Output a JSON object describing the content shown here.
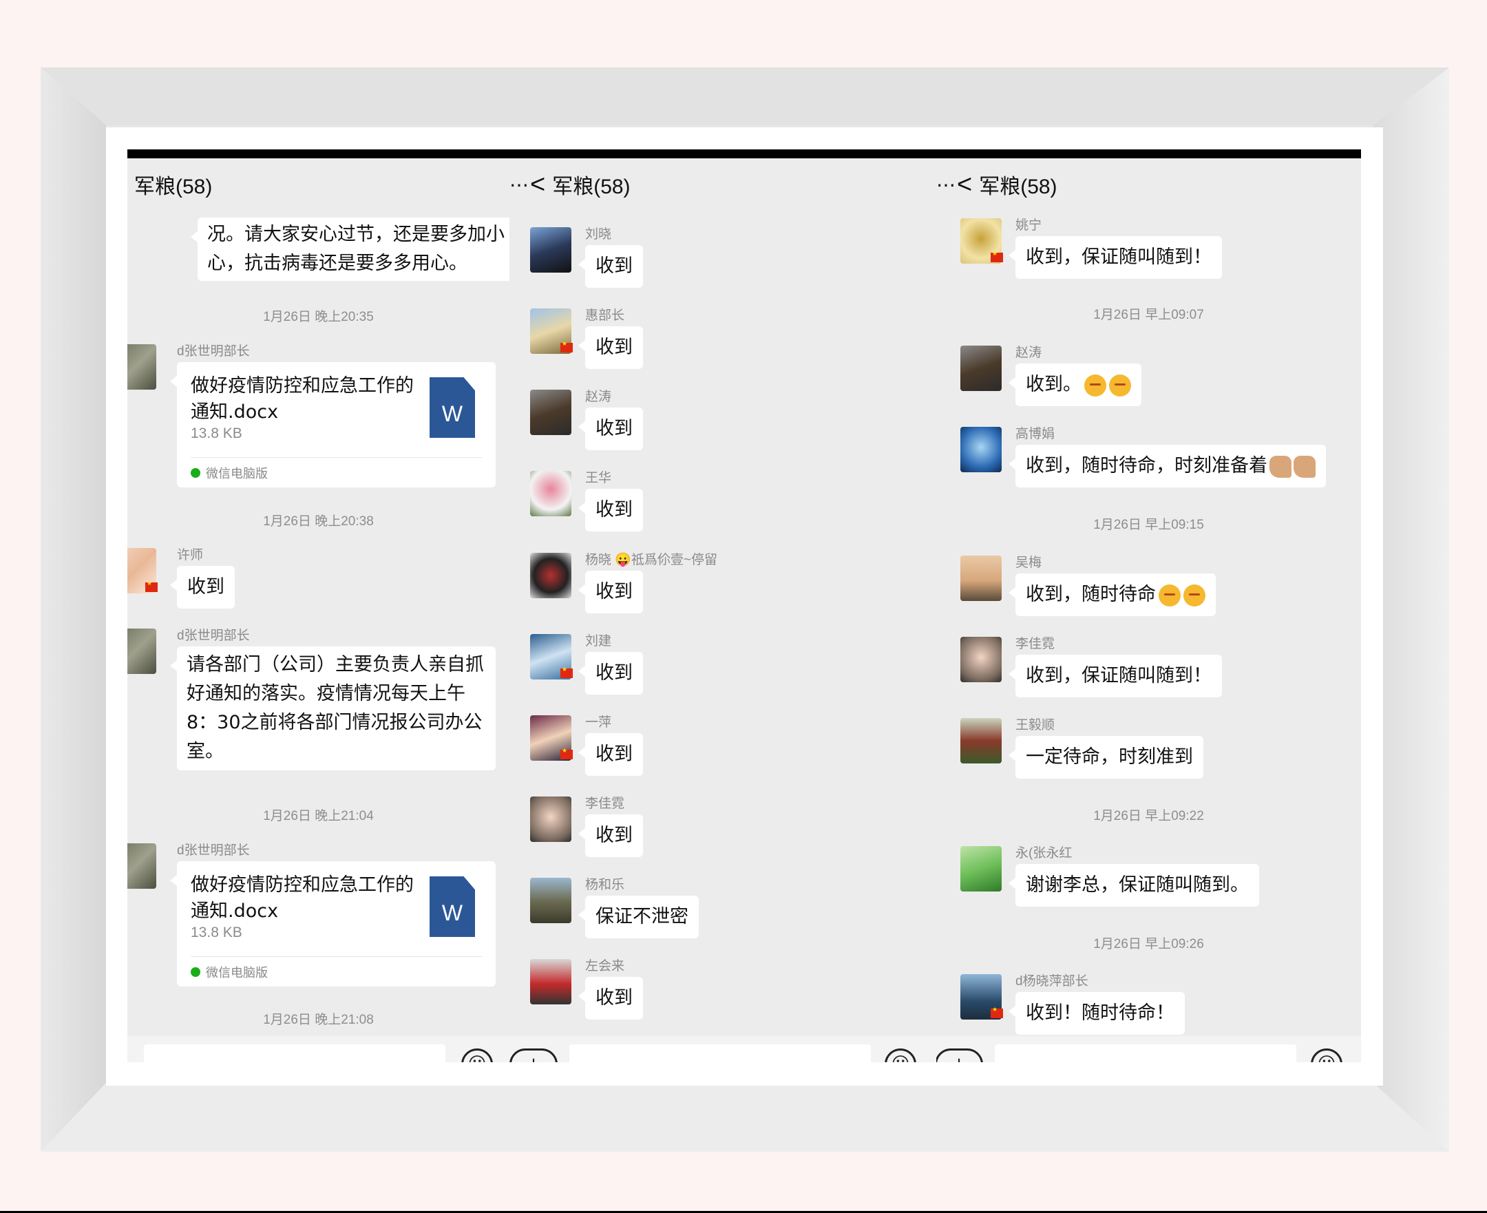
{
  "panels": [
    {
      "title": "军粮(58)",
      "messages": [
        {
          "kind": "text-partial",
          "text": "况。请大家安心过节，还是要多加小心，抗击病毒还是要多多用心。"
        },
        {
          "kind": "time",
          "text": "1月26日 晚上20:35"
        },
        {
          "kind": "file",
          "name": "d张世明部长",
          "file_name": "做好疫情防控和应急工作的通知.docx",
          "file_size": "13.8 KB",
          "source": "微信电脑版",
          "file_icon": "W"
        },
        {
          "kind": "time",
          "text": "1月26日 晚上20:38"
        },
        {
          "kind": "text",
          "name": "许师",
          "text": "收到"
        },
        {
          "kind": "text",
          "name": "d张世明部长",
          "text": "请各部门（公司）主要负责人亲自抓好通知的落实。疫情情况每天上午8：30之前将各部门情况报公司办公室。"
        },
        {
          "kind": "time",
          "text": "1月26日 晚上21:04"
        },
        {
          "kind": "file",
          "name": "d张世明部长",
          "file_name": "做好疫情防控和应急工作的通知.docx",
          "file_size": "13.8 KB",
          "source": "微信电脑版",
          "file_icon": "W"
        },
        {
          "kind": "time",
          "text": "1月26日 晚上21:08"
        }
      ]
    },
    {
      "title": "军粮(58)",
      "messages": [
        {
          "name": "刘晓",
          "text": "收到"
        },
        {
          "name": "惠部长",
          "text": "收到"
        },
        {
          "name": "赵涛",
          "text": "收到"
        },
        {
          "name": "王华",
          "text": "收到"
        },
        {
          "name": "杨晓 😛祗爲伱壹~停留",
          "text": "收到"
        },
        {
          "name": "刘建",
          "text": "收到"
        },
        {
          "name": "一萍",
          "text": "收到"
        },
        {
          "name": "李佳霓",
          "text": "收到"
        },
        {
          "name": "杨和乐",
          "text": "保证不泄密"
        },
        {
          "name": "左会来",
          "text": "收到"
        }
      ]
    },
    {
      "title": "军粮(58)",
      "messages": [
        {
          "kind": "text",
          "name": "姚宁",
          "text": "收到，保证随叫随到！"
        },
        {
          "kind": "time",
          "text": "1月26日 早上09:07"
        },
        {
          "kind": "text",
          "name": "赵涛",
          "text": "收到。"
        },
        {
          "kind": "text",
          "name": "高博娟",
          "text": "收到，随时待命，时刻准备着"
        },
        {
          "kind": "time",
          "text": "1月26日 早上09:15"
        },
        {
          "kind": "text",
          "name": "吴梅",
          "text": "收到，随时待命"
        },
        {
          "kind": "text",
          "name": "李佳霓",
          "text": "收到，保证随叫随到！"
        },
        {
          "kind": "text",
          "name": "王毅顺",
          "text": "一定待命，时刻准到"
        },
        {
          "kind": "time",
          "text": "1月26日 早上09:22"
        },
        {
          "kind": "text",
          "name": "永(张永红",
          "text": "谢谢李总，保证随叫随到。"
        },
        {
          "kind": "time",
          "text": "1月26日 早上09:26"
        },
        {
          "kind": "text",
          "name": "d杨晓萍部长",
          "text": "收到！随时待命！"
        }
      ]
    }
  ],
  "icons": {
    "more": "⋯",
    "back": "<",
    "emoji": "☺",
    "plus": "+"
  }
}
